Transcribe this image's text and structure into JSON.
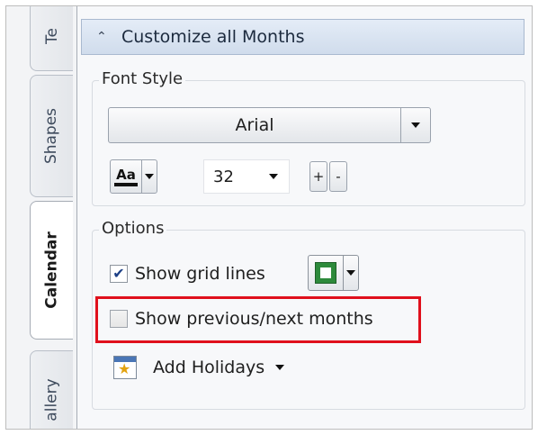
{
  "tabs": [
    {
      "label": "Te",
      "active": false
    },
    {
      "label": "Shapes",
      "active": false
    },
    {
      "label": "Calendar",
      "active": true
    },
    {
      "label": "allery",
      "active": false
    }
  ],
  "panel": {
    "title": "Customize all Months",
    "collapse_icon": "chevron-up-icon"
  },
  "font_style": {
    "legend": "Font Style",
    "font_name": "Arial",
    "font_color_label": "Aa",
    "font_size": "32",
    "increase_label": "+",
    "decrease_label": "-"
  },
  "options": {
    "legend": "Options",
    "show_grid_lines": {
      "label": "Show grid lines",
      "checked": true
    },
    "grid_color": "#2d8a3b",
    "show_prev_next": {
      "label": "Show previous/next months",
      "checked": false
    },
    "add_holidays": {
      "label": "Add Holidays",
      "icon": "calendar-star-icon"
    }
  },
  "highlight_color": "#e0101c"
}
